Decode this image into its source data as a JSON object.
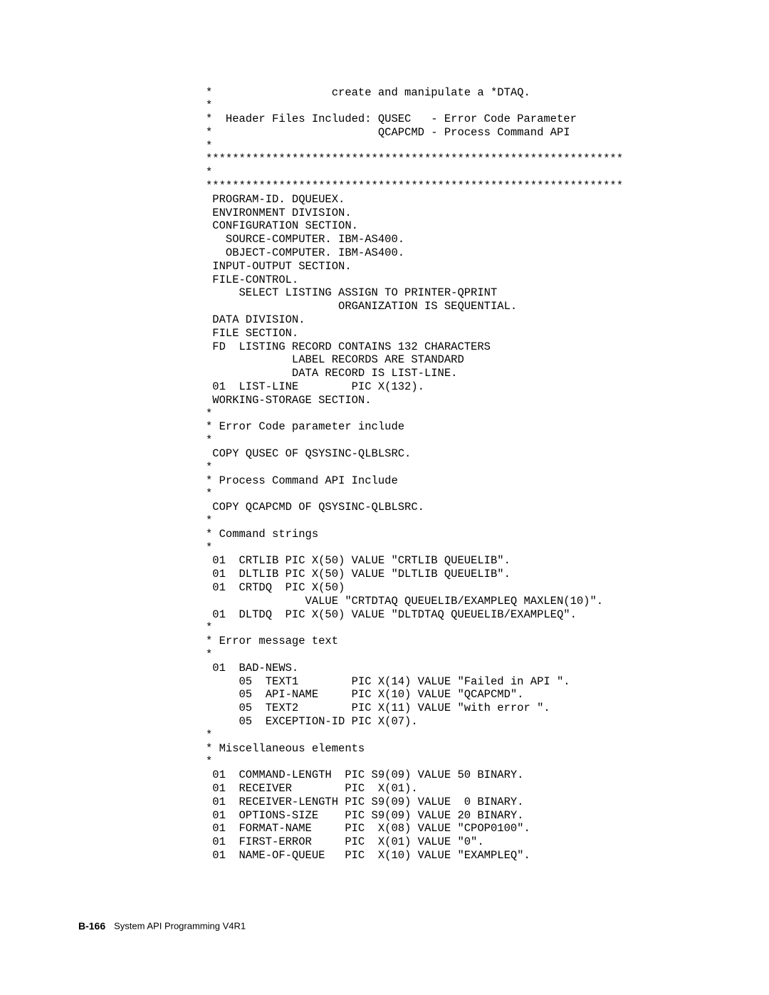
{
  "code": {
    "lines": [
      "*                  create and manipulate a *DTAQ.",
      "*",
      "*  Header Files Included: QUSEC   - Error Code Parameter",
      "*                         QCAPCMD - Process Command API",
      "*",
      "***************************************************************",
      "*",
      "***************************************************************",
      " PROGRAM-ID. DQUEUEX.",
      " ENVIRONMENT DIVISION.",
      " CONFIGURATION SECTION.",
      "   SOURCE-COMPUTER. IBM-AS400.",
      "   OBJECT-COMPUTER. IBM-AS400.",
      " INPUT-OUTPUT SECTION.",
      " FILE-CONTROL.",
      "     SELECT LISTING ASSIGN TO PRINTER-QPRINT",
      "                    ORGANIZATION IS SEQUENTIAL.",
      " DATA DIVISION.",
      " FILE SECTION.",
      " FD  LISTING RECORD CONTAINS 132 CHARACTERS",
      "             LABEL RECORDS ARE STANDARD",
      "             DATA RECORD IS LIST-LINE.",
      " 01  LIST-LINE        PIC X(132).",
      " WORKING-STORAGE SECTION.",
      "*",
      "* Error Code parameter include",
      "*",
      " COPY QUSEC OF QSYSINC-QLBLSRC.",
      "*",
      "* Process Command API Include",
      "*",
      " COPY QCAPCMD OF QSYSINC-QLBLSRC.",
      "*",
      "* Command strings",
      "*",
      " 01  CRTLIB PIC X(50) VALUE \"CRTLIB QUEUELIB\".",
      " 01  DLTLIB PIC X(50) VALUE \"DLTLIB QUEUELIB\".",
      " 01  CRTDQ  PIC X(50)",
      "               VALUE \"CRTDTAQ QUEUELIB/EXAMPLEQ MAXLEN(10)\".",
      " 01  DLTDQ  PIC X(50) VALUE \"DLTDTAQ QUEUELIB/EXAMPLEQ\".",
      "*",
      "* Error message text",
      "*",
      " 01  BAD-NEWS.",
      "     05  TEXT1        PIC X(14) VALUE \"Failed in API \".",
      "     05  API-NAME     PIC X(10) VALUE \"QCAPCMD\".",
      "     05  TEXT2        PIC X(11) VALUE \"with error \".",
      "     05  EXCEPTION-ID PIC X(07).",
      "*",
      "* Miscellaneous elements",
      "*",
      " 01  COMMAND-LENGTH  PIC S9(09) VALUE 50 BINARY.",
      " 01  RECEIVER        PIC  X(01).",
      " 01  RECEIVER-LENGTH PIC S9(09) VALUE  0 BINARY.",
      " 01  OPTIONS-SIZE    PIC S9(09) VALUE 20 BINARY.",
      " 01  FORMAT-NAME     PIC  X(08) VALUE \"CPOP0100\".",
      " 01  FIRST-ERROR     PIC  X(01) VALUE \"0\".",
      " 01  NAME-OF-QUEUE   PIC  X(10) VALUE \"EXAMPLEQ\"."
    ]
  },
  "footer": {
    "page": "B-166",
    "title": "System API Programming V4R1"
  }
}
